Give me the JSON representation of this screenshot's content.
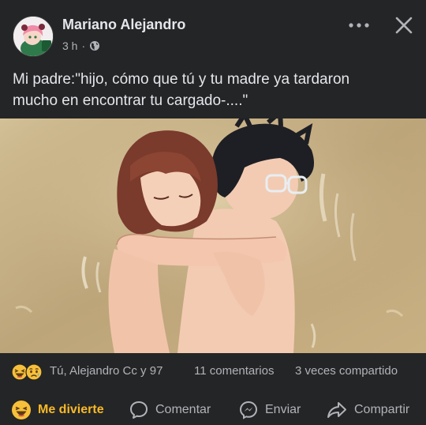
{
  "post": {
    "author": "Mariano Alejandro",
    "timestamp": "3 h",
    "separator": "·",
    "privacy_icon": "globe-icon",
    "more_icon": "more-horizontal-icon",
    "close_icon": "close-icon",
    "caption_lines": [
      "Mi padre:\"hijo, cómo que tú y tu madre ya tardaron",
      "mucho en encontrar tu cargado-....\""
    ]
  },
  "stats": {
    "reaction_icons": [
      "haha-emoji-icon",
      "sad-emoji-icon"
    ],
    "reactors": "Tú, Alejandro Cc y 97",
    "comments": "11 comentarios",
    "shares": "3 veces compartido"
  },
  "actions": {
    "react_label": "Me divierte",
    "comment_label": "Comentar",
    "send_label": "Enviar",
    "share_label": "Compartir"
  },
  "colors": {
    "background": "#242526",
    "text_primary": "#e4e6eb",
    "text_secondary": "#b0b3b8",
    "reaction_accent": "#f7b928"
  }
}
